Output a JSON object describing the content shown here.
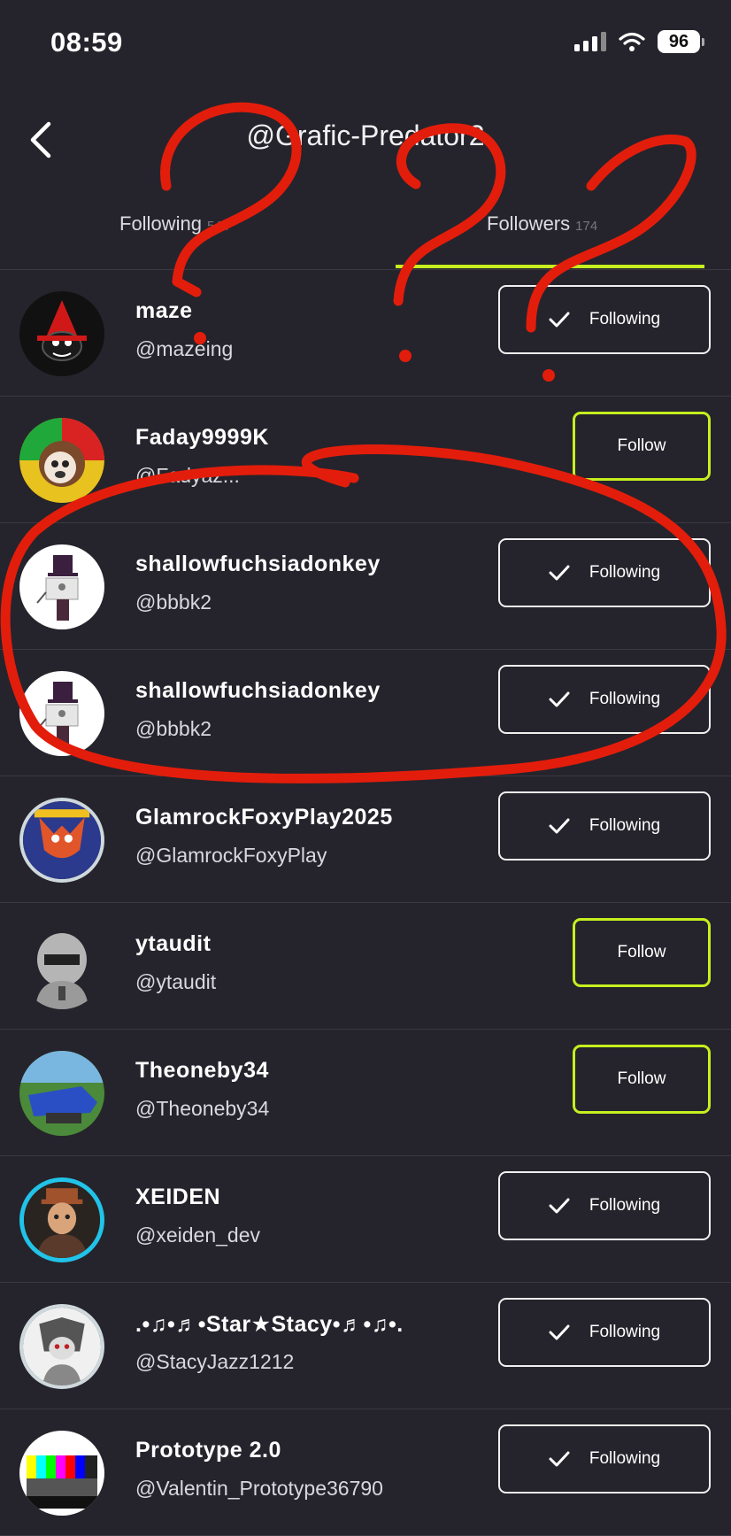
{
  "status_bar": {
    "time": "08:59",
    "battery": "96"
  },
  "header": {
    "title": "@Grafic-Predator2"
  },
  "tabs": [
    {
      "label": "Following",
      "count": "544"
    },
    {
      "label": "Followers",
      "count": "174"
    }
  ],
  "users": [
    {
      "name": "maze",
      "handle": "@mazeing",
      "button": "Following"
    },
    {
      "name": "Faday9999K",
      "handle": "@Fadyaz...",
      "button": "Follow"
    },
    {
      "name": "shallowfuchsiadonkey",
      "handle": "@bbbk2",
      "button": "Following"
    },
    {
      "name": "shallowfuchsiadonkey",
      "handle": "@bbbk2",
      "button": "Following"
    },
    {
      "name": "GlamrockFoxyPlay2025",
      "handle": "@GlamrockFoxyPlay",
      "button": "Following"
    },
    {
      "name": "ytaudit",
      "handle": "@ytaudit",
      "button": "Follow"
    },
    {
      "name": "Theoneby34",
      "handle": "@Theoneby34",
      "button": "Follow"
    },
    {
      "name": "XEIDEN",
      "handle": "@xeiden_dev",
      "button": "Following"
    },
    {
      "name": ".•♫•♬•Star★Stacy•♬•♫•.",
      "handle": "@StacyJazz1212",
      "button": "Following"
    },
    {
      "name": "Prototype 2.0",
      "handle": "@Valentin_Prototype36790",
      "button": "Following"
    }
  ],
  "colors": {
    "background": "#25242c",
    "accent": "#c6ef1f",
    "annotation": "#e31d0b"
  }
}
